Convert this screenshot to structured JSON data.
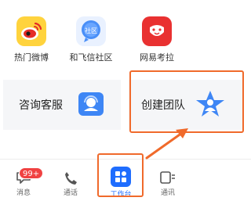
{
  "apps": [
    {
      "label": "热门微博",
      "icon": "weibo-icon"
    },
    {
      "label": "和飞信社区",
      "icon": "hefeixin-community-icon",
      "icon_text": "社区"
    },
    {
      "label": "网易考拉",
      "icon": "kaola-icon"
    }
  ],
  "cards": {
    "consult": {
      "label": "咨询客服",
      "icon": "customer-service-icon"
    },
    "team": {
      "label": "创建团队",
      "icon": "team-star-icon"
    }
  },
  "tabs": {
    "messages": {
      "label": "消息",
      "badge": "99+"
    },
    "calls": {
      "label": "通话"
    },
    "workbench": {
      "label": "工作台"
    },
    "contacts": {
      "label": "通讯"
    }
  },
  "colors": {
    "highlight": "#f06a2b",
    "accent_blue": "#1f6dfe",
    "weibo_yellow": "#ffd33d",
    "kaola_red": "#e93131",
    "badge_red": "#f04242"
  }
}
